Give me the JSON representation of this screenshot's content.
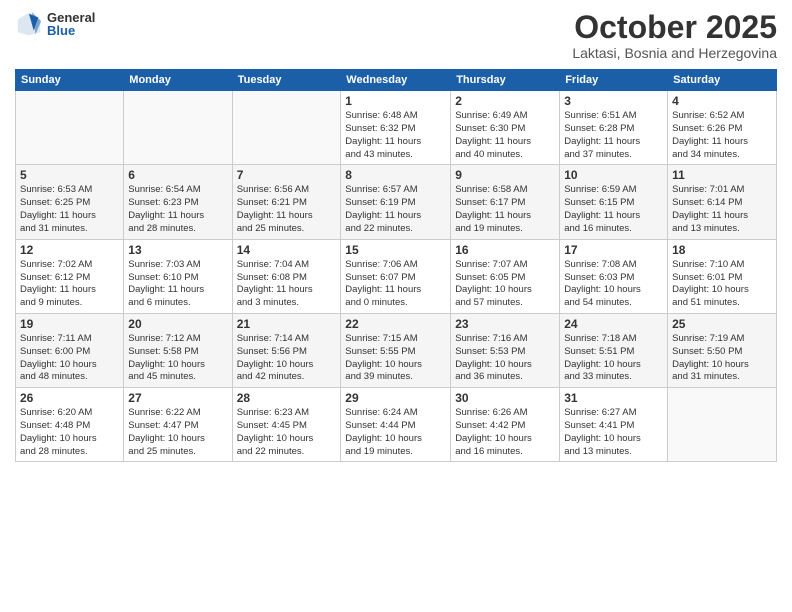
{
  "logo": {
    "general": "General",
    "blue": "Blue"
  },
  "title": "October 2025",
  "subtitle": "Laktasi, Bosnia and Herzegovina",
  "days": [
    "Sunday",
    "Monday",
    "Tuesday",
    "Wednesday",
    "Thursday",
    "Friday",
    "Saturday"
  ],
  "weeks": [
    [
      {
        "day": "",
        "info": ""
      },
      {
        "day": "",
        "info": ""
      },
      {
        "day": "",
        "info": ""
      },
      {
        "day": "1",
        "info": "Sunrise: 6:48 AM\nSunset: 6:32 PM\nDaylight: 11 hours\nand 43 minutes."
      },
      {
        "day": "2",
        "info": "Sunrise: 6:49 AM\nSunset: 6:30 PM\nDaylight: 11 hours\nand 40 minutes."
      },
      {
        "day": "3",
        "info": "Sunrise: 6:51 AM\nSunset: 6:28 PM\nDaylight: 11 hours\nand 37 minutes."
      },
      {
        "day": "4",
        "info": "Sunrise: 6:52 AM\nSunset: 6:26 PM\nDaylight: 11 hours\nand 34 minutes."
      }
    ],
    [
      {
        "day": "5",
        "info": "Sunrise: 6:53 AM\nSunset: 6:25 PM\nDaylight: 11 hours\nand 31 minutes."
      },
      {
        "day": "6",
        "info": "Sunrise: 6:54 AM\nSunset: 6:23 PM\nDaylight: 11 hours\nand 28 minutes."
      },
      {
        "day": "7",
        "info": "Sunrise: 6:56 AM\nSunset: 6:21 PM\nDaylight: 11 hours\nand 25 minutes."
      },
      {
        "day": "8",
        "info": "Sunrise: 6:57 AM\nSunset: 6:19 PM\nDaylight: 11 hours\nand 22 minutes."
      },
      {
        "day": "9",
        "info": "Sunrise: 6:58 AM\nSunset: 6:17 PM\nDaylight: 11 hours\nand 19 minutes."
      },
      {
        "day": "10",
        "info": "Sunrise: 6:59 AM\nSunset: 6:15 PM\nDaylight: 11 hours\nand 16 minutes."
      },
      {
        "day": "11",
        "info": "Sunrise: 7:01 AM\nSunset: 6:14 PM\nDaylight: 11 hours\nand 13 minutes."
      }
    ],
    [
      {
        "day": "12",
        "info": "Sunrise: 7:02 AM\nSunset: 6:12 PM\nDaylight: 11 hours\nand 9 minutes."
      },
      {
        "day": "13",
        "info": "Sunrise: 7:03 AM\nSunset: 6:10 PM\nDaylight: 11 hours\nand 6 minutes."
      },
      {
        "day": "14",
        "info": "Sunrise: 7:04 AM\nSunset: 6:08 PM\nDaylight: 11 hours\nand 3 minutes."
      },
      {
        "day": "15",
        "info": "Sunrise: 7:06 AM\nSunset: 6:07 PM\nDaylight: 11 hours\nand 0 minutes."
      },
      {
        "day": "16",
        "info": "Sunrise: 7:07 AM\nSunset: 6:05 PM\nDaylight: 10 hours\nand 57 minutes."
      },
      {
        "day": "17",
        "info": "Sunrise: 7:08 AM\nSunset: 6:03 PM\nDaylight: 10 hours\nand 54 minutes."
      },
      {
        "day": "18",
        "info": "Sunrise: 7:10 AM\nSunset: 6:01 PM\nDaylight: 10 hours\nand 51 minutes."
      }
    ],
    [
      {
        "day": "19",
        "info": "Sunrise: 7:11 AM\nSunset: 6:00 PM\nDaylight: 10 hours\nand 48 minutes."
      },
      {
        "day": "20",
        "info": "Sunrise: 7:12 AM\nSunset: 5:58 PM\nDaylight: 10 hours\nand 45 minutes."
      },
      {
        "day": "21",
        "info": "Sunrise: 7:14 AM\nSunset: 5:56 PM\nDaylight: 10 hours\nand 42 minutes."
      },
      {
        "day": "22",
        "info": "Sunrise: 7:15 AM\nSunset: 5:55 PM\nDaylight: 10 hours\nand 39 minutes."
      },
      {
        "day": "23",
        "info": "Sunrise: 7:16 AM\nSunset: 5:53 PM\nDaylight: 10 hours\nand 36 minutes."
      },
      {
        "day": "24",
        "info": "Sunrise: 7:18 AM\nSunset: 5:51 PM\nDaylight: 10 hours\nand 33 minutes."
      },
      {
        "day": "25",
        "info": "Sunrise: 7:19 AM\nSunset: 5:50 PM\nDaylight: 10 hours\nand 31 minutes."
      }
    ],
    [
      {
        "day": "26",
        "info": "Sunrise: 6:20 AM\nSunset: 4:48 PM\nDaylight: 10 hours\nand 28 minutes."
      },
      {
        "day": "27",
        "info": "Sunrise: 6:22 AM\nSunset: 4:47 PM\nDaylight: 10 hours\nand 25 minutes."
      },
      {
        "day": "28",
        "info": "Sunrise: 6:23 AM\nSunset: 4:45 PM\nDaylight: 10 hours\nand 22 minutes."
      },
      {
        "day": "29",
        "info": "Sunrise: 6:24 AM\nSunset: 4:44 PM\nDaylight: 10 hours\nand 19 minutes."
      },
      {
        "day": "30",
        "info": "Sunrise: 6:26 AM\nSunset: 4:42 PM\nDaylight: 10 hours\nand 16 minutes."
      },
      {
        "day": "31",
        "info": "Sunrise: 6:27 AM\nSunset: 4:41 PM\nDaylight: 10 hours\nand 13 minutes."
      },
      {
        "day": "",
        "info": ""
      }
    ]
  ]
}
